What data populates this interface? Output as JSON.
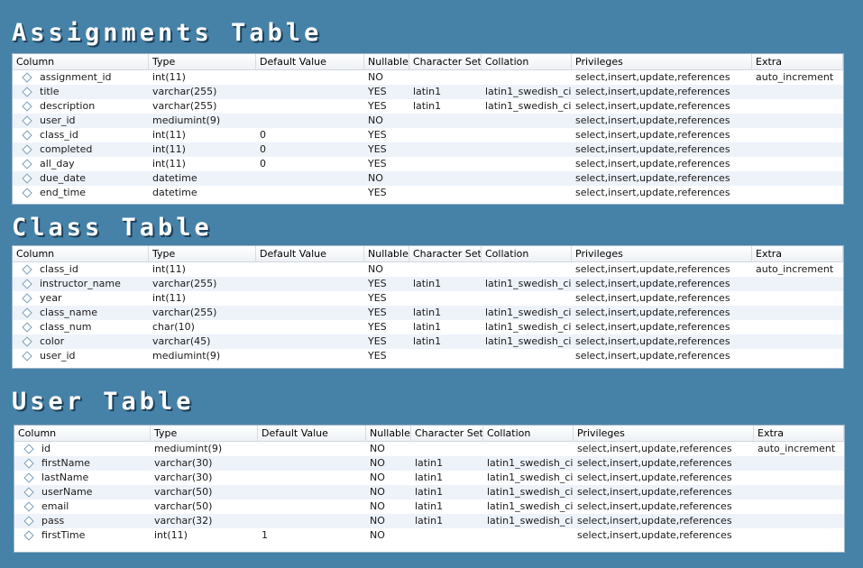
{
  "columns": [
    "Column",
    "Type",
    "Default Value",
    "Nullable",
    "Character Set",
    "Collation",
    "Privileges",
    "Extra"
  ],
  "tables": [
    {
      "title": "Assignments Table",
      "rows": [
        [
          "assignment_id",
          "int(11)",
          "",
          "NO",
          "",
          "",
          "select,insert,update,references",
          "auto_increment"
        ],
        [
          "title",
          "varchar(255)",
          "",
          "YES",
          "latin1",
          "latin1_swedish_ci",
          "select,insert,update,references",
          ""
        ],
        [
          "description",
          "varchar(255)",
          "",
          "YES",
          "latin1",
          "latin1_swedish_ci",
          "select,insert,update,references",
          ""
        ],
        [
          "user_id",
          "mediumint(9)",
          "",
          "NO",
          "",
          "",
          "select,insert,update,references",
          ""
        ],
        [
          "class_id",
          "int(11)",
          "0",
          "YES",
          "",
          "",
          "select,insert,update,references",
          ""
        ],
        [
          "completed",
          "int(11)",
          "0",
          "YES",
          "",
          "",
          "select,insert,update,references",
          ""
        ],
        [
          "all_day",
          "int(11)",
          "0",
          "YES",
          "",
          "",
          "select,insert,update,references",
          ""
        ],
        [
          "due_date",
          "datetime",
          "",
          "NO",
          "",
          "",
          "select,insert,update,references",
          ""
        ],
        [
          "end_time",
          "datetime",
          "",
          "YES",
          "",
          "",
          "select,insert,update,references",
          ""
        ]
      ]
    },
    {
      "title": "Class Table",
      "rows": [
        [
          "class_id",
          "int(11)",
          "",
          "NO",
          "",
          "",
          "select,insert,update,references",
          "auto_increment"
        ],
        [
          "instructor_name",
          "varchar(255)",
          "",
          "YES",
          "latin1",
          "latin1_swedish_ci",
          "select,insert,update,references",
          ""
        ],
        [
          "year",
          "int(11)",
          "",
          "YES",
          "",
          "",
          "select,insert,update,references",
          ""
        ],
        [
          "class_name",
          "varchar(255)",
          "",
          "YES",
          "latin1",
          "latin1_swedish_ci",
          "select,insert,update,references",
          ""
        ],
        [
          "class_num",
          "char(10)",
          "",
          "YES",
          "latin1",
          "latin1_swedish_ci",
          "select,insert,update,references",
          ""
        ],
        [
          "color",
          "varchar(45)",
          "",
          "YES",
          "latin1",
          "latin1_swedish_ci",
          "select,insert,update,references",
          ""
        ],
        [
          "user_id",
          "mediumint(9)",
          "",
          "YES",
          "",
          "",
          "select,insert,update,references",
          ""
        ]
      ]
    },
    {
      "title": "User Table",
      "rows": [
        [
          "id",
          "mediumint(9)",
          "",
          "NO",
          "",
          "",
          "select,insert,update,references",
          "auto_increment"
        ],
        [
          "firstName",
          "varchar(30)",
          "",
          "NO",
          "latin1",
          "latin1_swedish_ci",
          "select,insert,update,references",
          ""
        ],
        [
          "lastName",
          "varchar(30)",
          "",
          "NO",
          "latin1",
          "latin1_swedish_ci",
          "select,insert,update,references",
          ""
        ],
        [
          "userName",
          "varchar(50)",
          "",
          "NO",
          "latin1",
          "latin1_swedish_ci",
          "select,insert,update,references",
          ""
        ],
        [
          "email",
          "varchar(50)",
          "",
          "NO",
          "latin1",
          "latin1_swedish_ci",
          "select,insert,update,references",
          ""
        ],
        [
          "pass",
          "varchar(32)",
          "",
          "NO",
          "latin1",
          "latin1_swedish_ci",
          "select,insert,update,references",
          ""
        ],
        [
          "firstTime",
          "int(11)",
          "1",
          "NO",
          "",
          "",
          "select,insert,update,references",
          ""
        ]
      ]
    }
  ],
  "colors": {
    "background": "#4682a8",
    "row_alt": "#eef3fa"
  },
  "icons": {
    "column_marker": "diamond-icon"
  }
}
